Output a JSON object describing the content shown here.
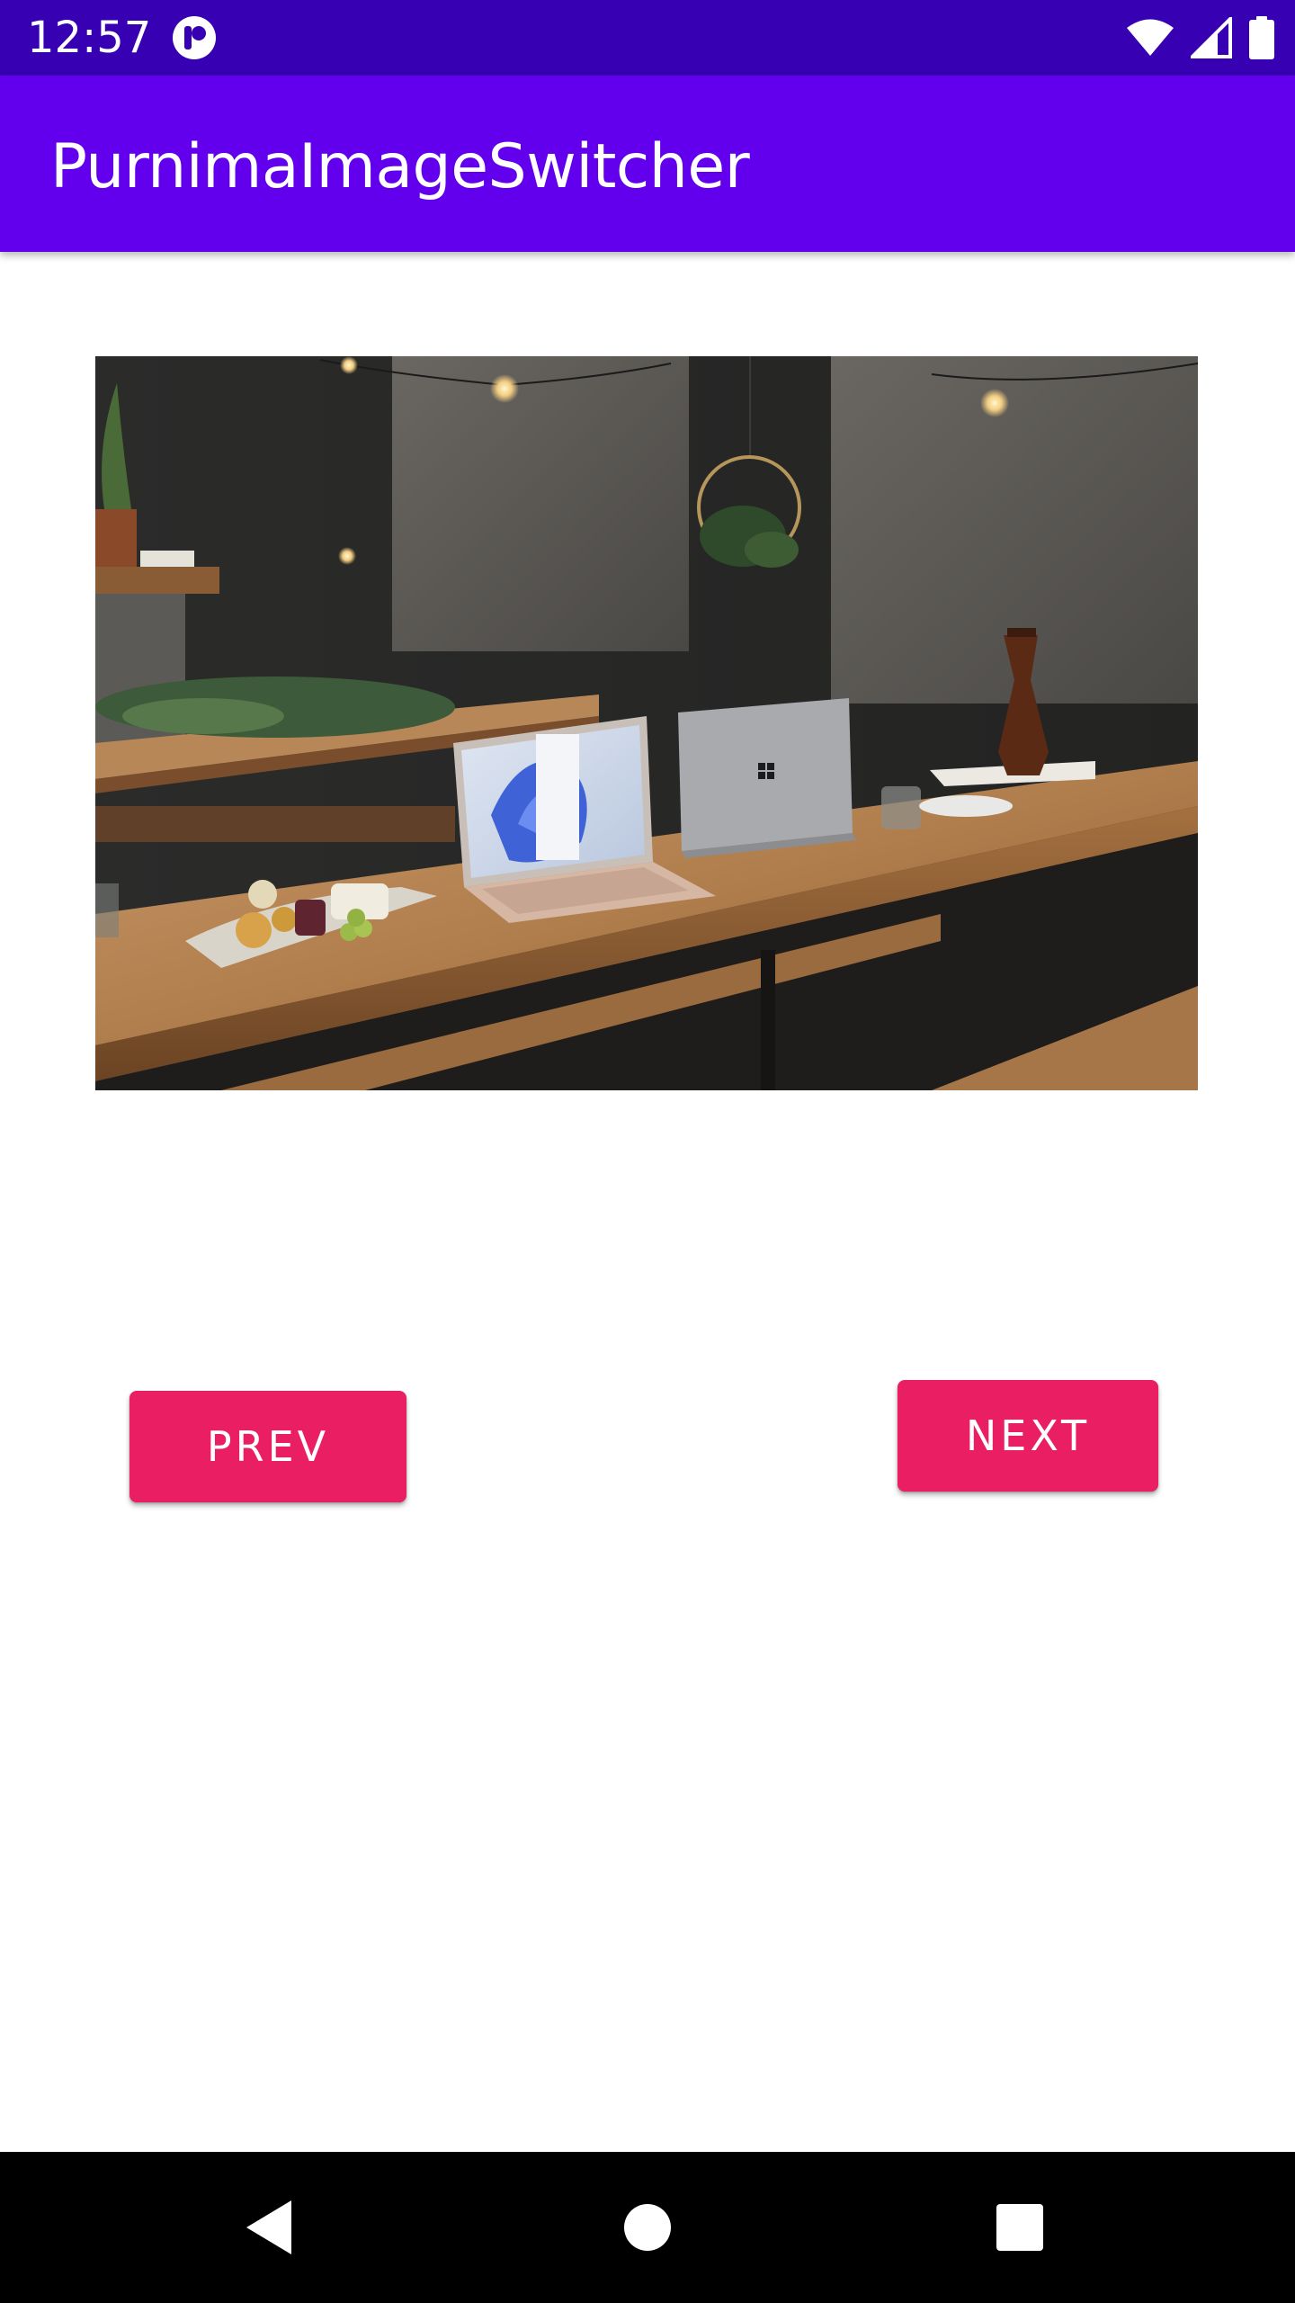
{
  "status_bar": {
    "time": "12:57",
    "icons": [
      "app-notification-icon",
      "wifi-icon",
      "cellular-signal-icon",
      "battery-icon"
    ],
    "background": "#3700B3"
  },
  "app_bar": {
    "title": "PurnimaImageSwitcher",
    "background": "#6200EE"
  },
  "image_switcher": {
    "description_icon": "laptops-on-wooden-table-photo"
  },
  "buttons": {
    "prev_label": "PREV",
    "next_label": "NEXT",
    "color": "#E91E63"
  },
  "nav_bar": {
    "icons": [
      "back-icon",
      "home-icon",
      "recents-icon"
    ],
    "background": "#000000"
  }
}
